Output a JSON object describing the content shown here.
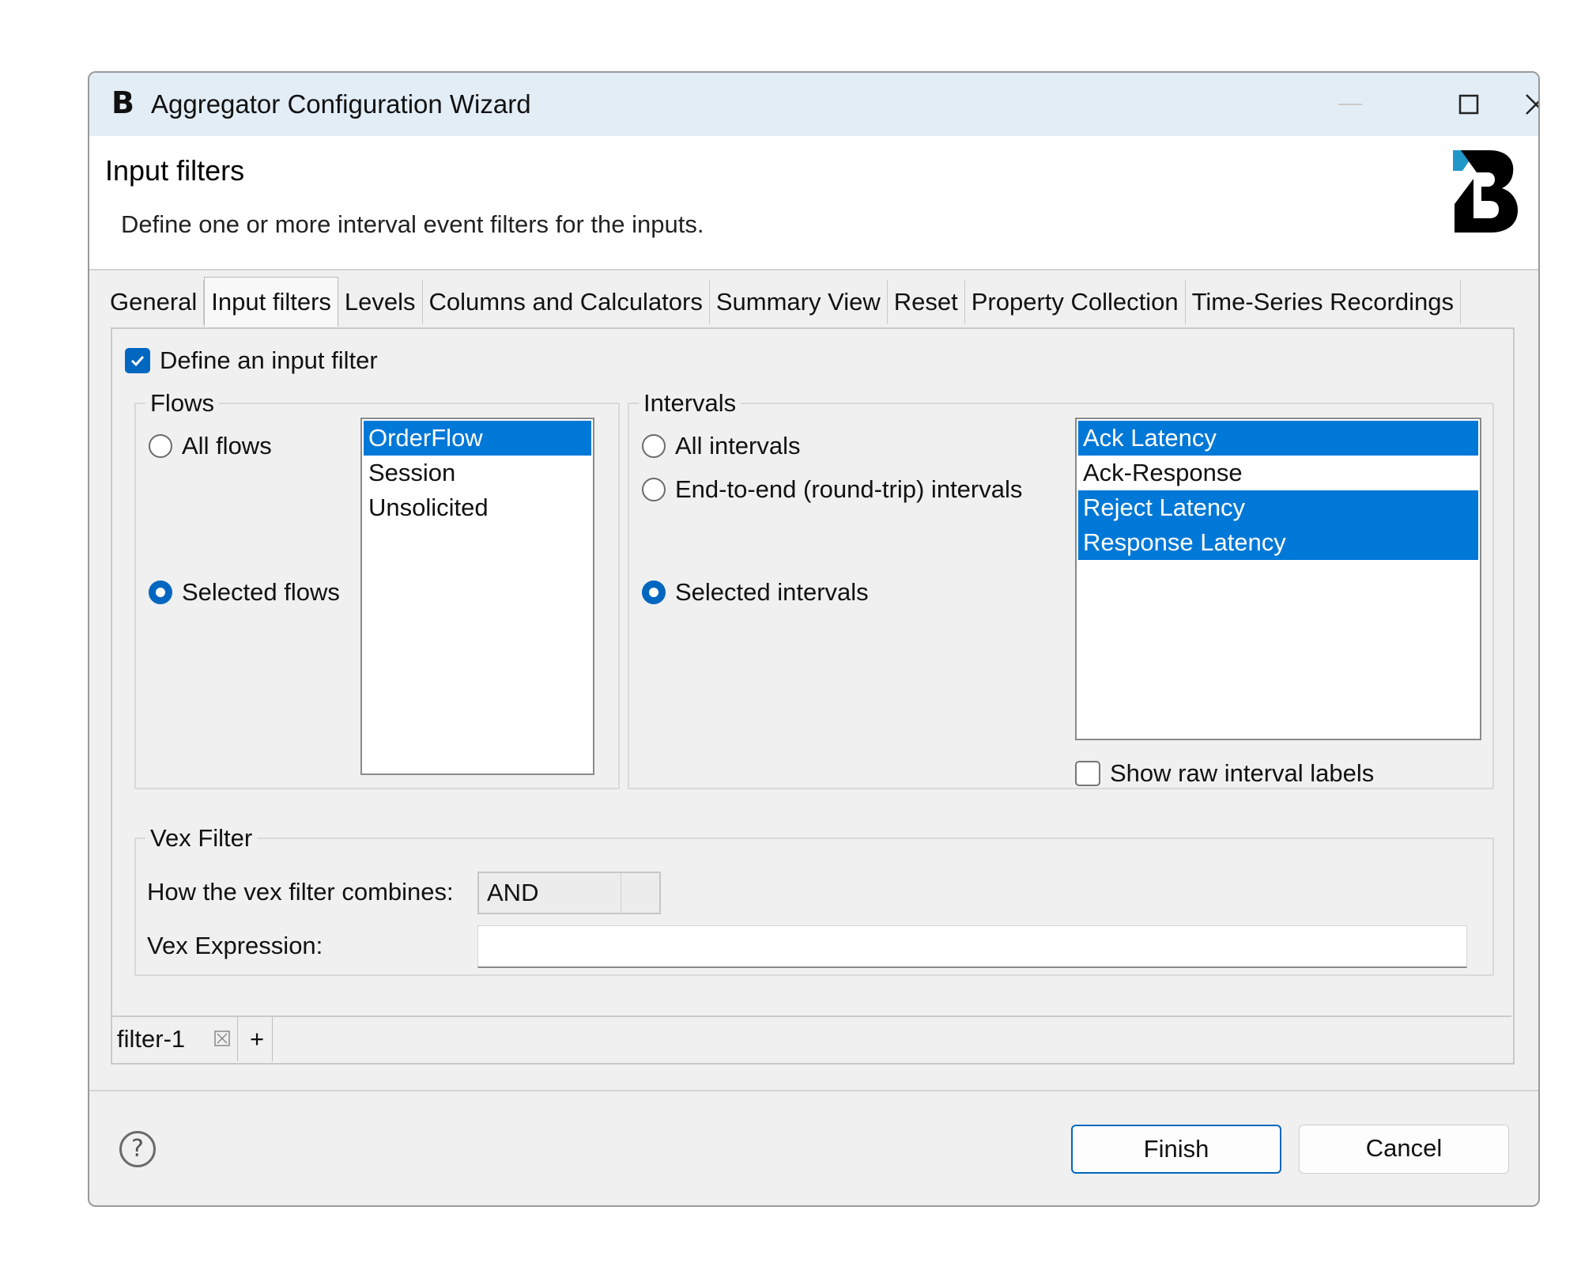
{
  "window": {
    "title": "Aggregator Configuration Wizard",
    "app_icon": "B",
    "controls": [
      "minimize-icon",
      "maximize-icon",
      "close-icon"
    ]
  },
  "header": {
    "title": "Input filters",
    "description": "Define one or more interval event filters for the inputs.",
    "logo": "brand-b-logo"
  },
  "tabs": [
    {
      "label": "General",
      "active": false
    },
    {
      "label": "Input filters",
      "active": true
    },
    {
      "label": "Levels",
      "active": false
    },
    {
      "label": "Columns and Calculators",
      "active": false
    },
    {
      "label": "Summary View",
      "active": false
    },
    {
      "label": "Reset",
      "active": false
    },
    {
      "label": "Property Collection",
      "active": false
    },
    {
      "label": "Time-Series Recordings",
      "active": false
    }
  ],
  "define_filter": {
    "label": "Define an input filter",
    "checked": true
  },
  "flows": {
    "legend": "Flows",
    "all_label": "All flows",
    "selected_label": "Selected flows",
    "mode": "selected",
    "items": [
      {
        "label": "OrderFlow",
        "selected": true
      },
      {
        "label": "Session",
        "selected": false
      },
      {
        "label": "Unsolicited",
        "selected": false
      }
    ]
  },
  "intervals": {
    "legend": "Intervals",
    "all_label": "All intervals",
    "end_to_end_label": "End-to-end (round-trip) intervals",
    "selected_label": "Selected intervals",
    "mode": "selected",
    "items": [
      {
        "label": "Ack Latency",
        "selected": true
      },
      {
        "label": "Ack-Response",
        "selected": false
      },
      {
        "label": "Reject Latency",
        "selected": true
      },
      {
        "label": "Response Latency",
        "selected": true
      }
    ],
    "raw_labels": {
      "label": "Show raw interval labels",
      "checked": false
    }
  },
  "vex": {
    "legend": "Vex Filter",
    "combine_label": "How the vex filter combines:",
    "combine_value": "AND",
    "expression_label": "Vex Expression:",
    "expression_value": ""
  },
  "filter_tabs": {
    "items": [
      {
        "label": "filter-1"
      }
    ],
    "add_label": "+"
  },
  "footer": {
    "finish_label": "Finish",
    "cancel_label": "Cancel",
    "help_label": "?"
  },
  "colors": {
    "accent": "#0067c0",
    "selection": "#0078d7",
    "titlebar": "#e3edf6"
  }
}
